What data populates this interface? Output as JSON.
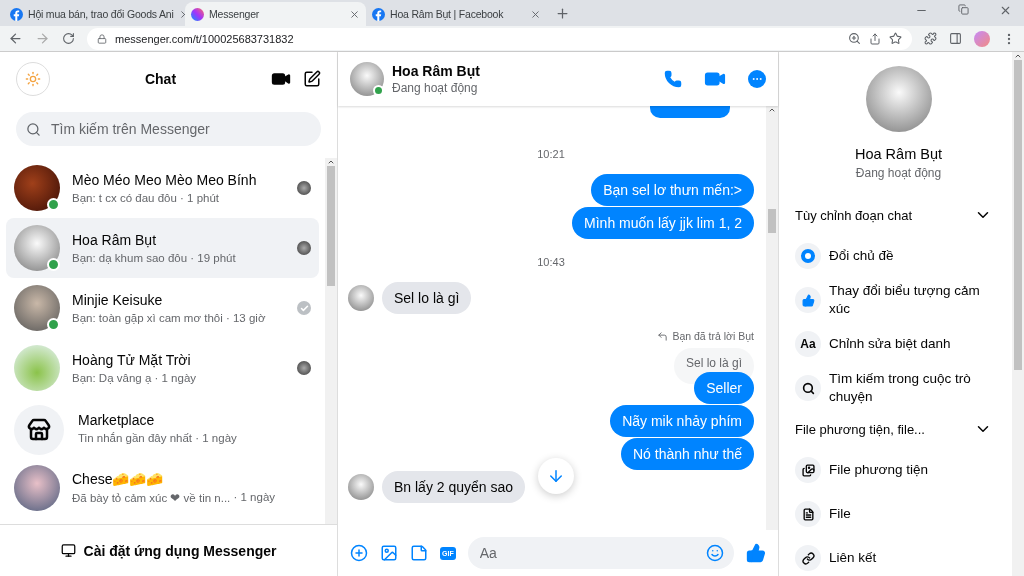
{
  "browser": {
    "tabs": [
      {
        "title": "Hội mua bán, trao đổi Goods Ani",
        "kind": "facebook",
        "selected": false
      },
      {
        "title": "Messenger",
        "kind": "messenger",
        "selected": true
      },
      {
        "title": "Hoa Râm Bụt | Facebook",
        "kind": "facebook",
        "selected": false
      }
    ],
    "url": "messenger.com/t/100025683731832"
  },
  "sidebar": {
    "title": "Chat",
    "search": {
      "placeholder": "Tìm kiếm trên Messenger"
    },
    "conversations": [
      {
        "kind": "person",
        "name": "Mèo Méo Meo Mèo Meo Bính",
        "preview": "Bạn: t cx có đau đôu",
        "time": "· 1 phút",
        "online": true,
        "selected": false,
        "seen": true,
        "delivered": false
      },
      {
        "kind": "person",
        "name": "Hoa Râm Bụt",
        "preview": "Bạn: dạ khum sao đôu",
        "time": "· 19 phút",
        "online": true,
        "selected": true,
        "seen": true,
        "delivered": false
      },
      {
        "kind": "person",
        "name": "Minjie Keisuke",
        "preview": "Bạn: toàn gặp xì cam mơ thôi",
        "time": "· 13 giờ",
        "online": true,
        "selected": false,
        "seen": false,
        "delivered": true
      },
      {
        "kind": "person",
        "name": "Hoàng Tử Mặt Trời",
        "preview": "Bạn: Dạ vâng ạ",
        "time": "· 1 ngày",
        "online": false,
        "selected": false,
        "seen": true,
        "delivered": false
      },
      {
        "kind": "marketplace",
        "name": "Marketplace",
        "preview": "Tin nhắn gần đây nhất",
        "time": "· 1 ngày",
        "online": false,
        "selected": false,
        "seen": false,
        "delivered": false
      },
      {
        "kind": "person",
        "name": "Chese🧀🧀🧀",
        "preview": "Đã bày tỏ cảm xúc ❤ về tin n...",
        "time": "· 1 ngày",
        "online": false,
        "selected": false,
        "seen": false,
        "delivered": false
      }
    ],
    "install_button": "Cài đặt ứng dụng Messenger"
  },
  "chat": {
    "name": "Hoa Râm Bụt",
    "status": "Đang hoạt động",
    "online": true,
    "messages": [
      {
        "kind": "time",
        "text": "10:21"
      },
      {
        "kind": "outgoing",
        "text": "Bạn sel lơ thưn mến:>"
      },
      {
        "kind": "outgoing",
        "text": "Mình muốn lấy jjk lim 1, 2"
      },
      {
        "kind": "time",
        "text": "10:43"
      },
      {
        "kind": "incoming",
        "text": "Sel lo là gì"
      },
      {
        "kind": "reply_note",
        "text": "Bạn đã trả lời Bụt"
      },
      {
        "kind": "quoted",
        "text": "Sel lo là gì"
      },
      {
        "kind": "outgoing",
        "text": "Seller"
      },
      {
        "kind": "outgoing",
        "text": "Nãy mik nhảy phím"
      },
      {
        "kind": "outgoing",
        "text": "Nó thành như thế"
      },
      {
        "kind": "incoming",
        "text": "Bn lấy 2 quyển sao"
      }
    ],
    "composer": {
      "placeholder": "Aa",
      "gif_label": "GIF"
    }
  },
  "info": {
    "name": "Hoa Râm Bụt",
    "status": "Đang hoạt động",
    "sections": [
      {
        "title": "Tùy chỉnh đoạn chat",
        "expanded": true,
        "items": [
          {
            "kind": "theme",
            "label": "Đổi chủ đề"
          },
          {
            "kind": "emoji",
            "label": "Thay đổi biểu tượng cảm xúc"
          },
          {
            "kind": "nickname",
            "icon_text": "Aa",
            "label": "Chỉnh sửa biệt danh"
          },
          {
            "kind": "search",
            "label": "Tìm kiếm trong cuộc trò chuyện"
          }
        ]
      },
      {
        "title": "File phương tiện, file...",
        "expanded": true,
        "items": [
          {
            "kind": "media",
            "label": "File phương tiện"
          },
          {
            "kind": "file",
            "label": "File"
          },
          {
            "kind": "link",
            "label": "Liên kết"
          }
        ]
      }
    ]
  }
}
